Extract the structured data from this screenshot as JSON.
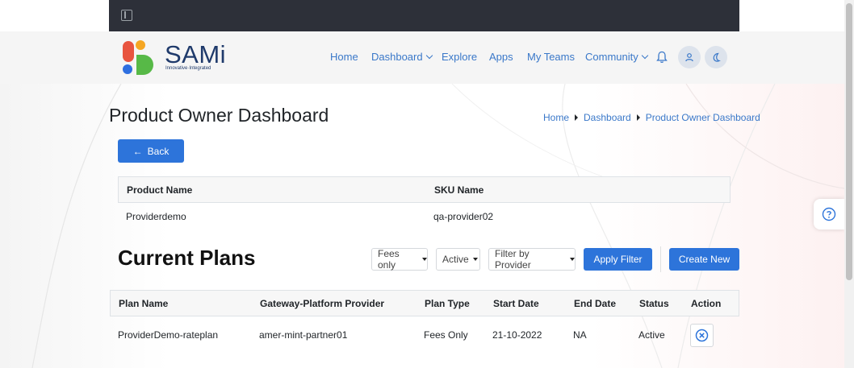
{
  "header": {
    "brand": "SAMi",
    "tagline": "Innovative·Integrated",
    "nav": [
      {
        "label": "Home",
        "dropdown": false
      },
      {
        "label": "Dashboard",
        "dropdown": true
      },
      {
        "label": "Explore",
        "dropdown": false
      },
      {
        "label": "Apps",
        "dropdown": false
      },
      {
        "label": "My Teams",
        "dropdown": false
      },
      {
        "label": "Community",
        "dropdown": true
      }
    ],
    "icons": [
      "bell-icon",
      "user-icon",
      "moon-icon"
    ]
  },
  "page": {
    "title": "Product Owner Dashboard",
    "breadcrumb": [
      "Home",
      "Dashboard",
      "Product Owner Dashboard"
    ],
    "back_label": "Back"
  },
  "product": {
    "headers": [
      "Product Name",
      "SKU Name"
    ],
    "row": [
      "Providerdemo",
      "qa-provider02"
    ]
  },
  "plans": {
    "title": "Current Plans",
    "filters": {
      "fees": "Fees only",
      "status": "Active",
      "provider": "Filter by Provider"
    },
    "apply_label": "Apply Filter",
    "create_label": "Create New",
    "headers": [
      "Plan Name",
      "Gateway-Platform Provider",
      "Plan Type",
      "Start Date",
      "End Date",
      "Status",
      "Action"
    ],
    "rows": [
      [
        "ProviderDemo-rateplan",
        "amer-mint-partner01",
        "Fees Only",
        "21-10-2022",
        "NA",
        "Active"
      ]
    ]
  },
  "colors": {
    "primary": "#2d74da",
    "link": "#3a78c9",
    "topbar": "#2d3039"
  }
}
